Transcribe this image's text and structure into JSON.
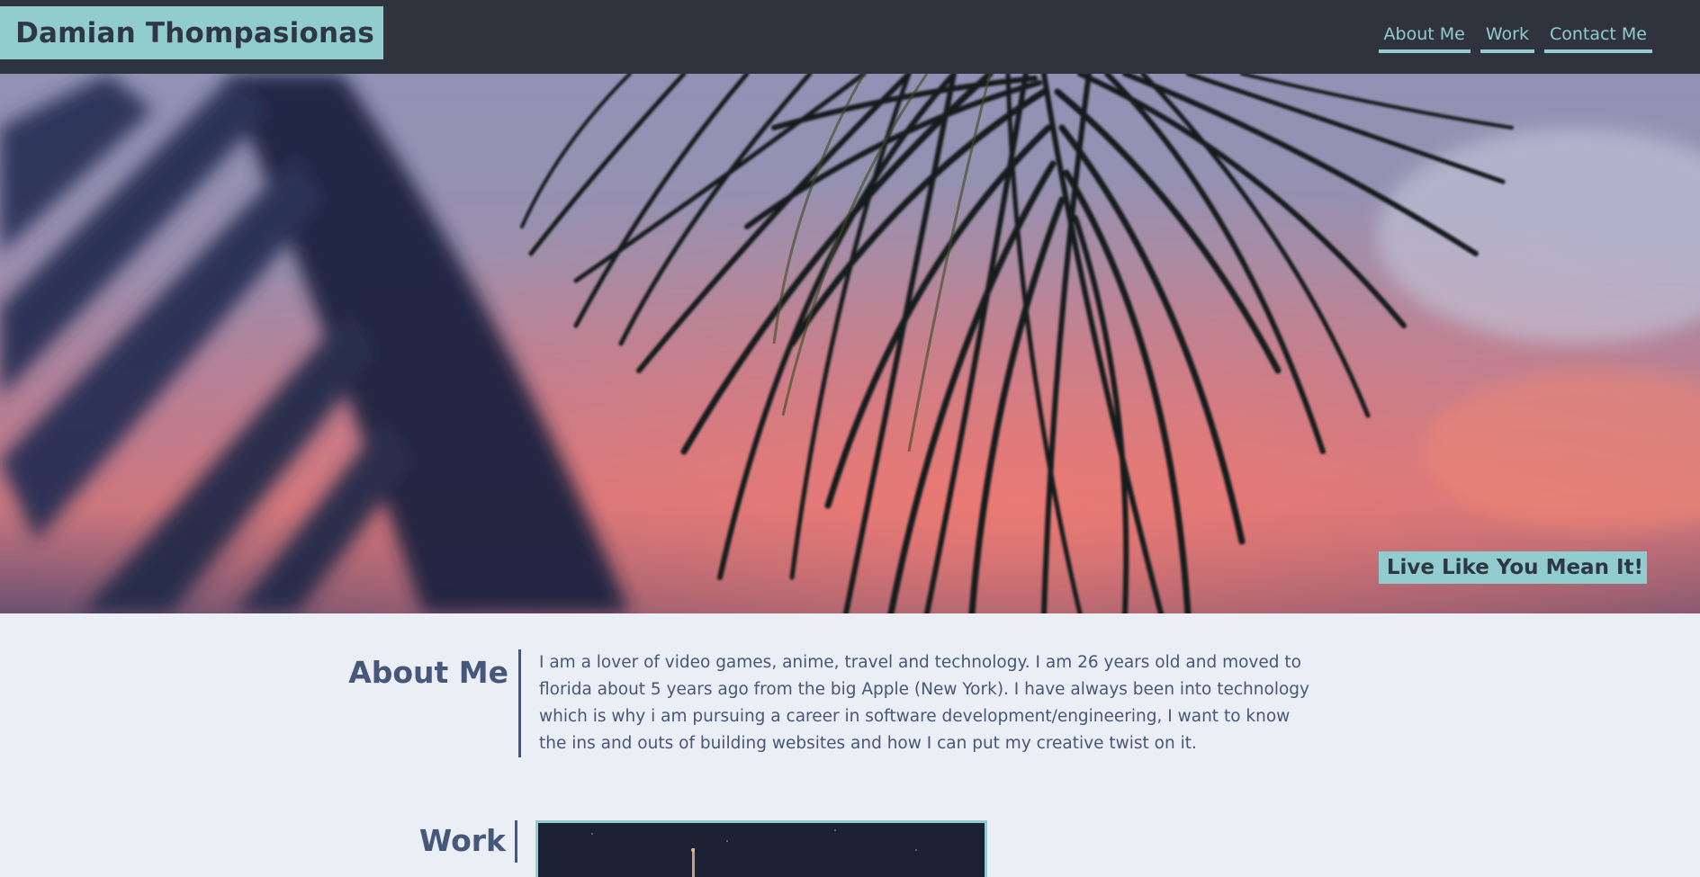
{
  "header": {
    "brand": "Damian Thompasionas",
    "nav": [
      {
        "label": "About Me"
      },
      {
        "label": "Work"
      },
      {
        "label": "Contact Me"
      }
    ]
  },
  "hero": {
    "tagline": "Live Like You Mean It!"
  },
  "about": {
    "title": "About Me",
    "text": "I am a lover of video games, anime, travel and technology. I am 26 years old and moved to florida about 5 years ago from the big Apple (New York). I have always been into technology which is why i am pursuing a career in software development/engineering, I want to know the ins and outs of building websites and how I can put my creative twist on it."
  },
  "work": {
    "title": "Work"
  },
  "colors": {
    "header_bg": "#2f333d",
    "accent": "#91cdcf",
    "text": "#45577a",
    "page_bg": "#eceef5"
  }
}
